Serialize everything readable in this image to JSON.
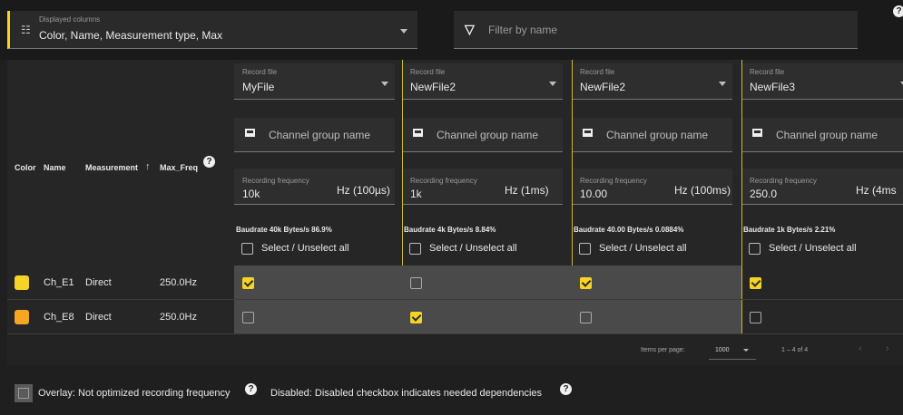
{
  "toolbar": {
    "columns_label": "Displayed columns",
    "columns_value": "Color, Name, Measurement type, Max",
    "filter_placeholder": "Filter by name"
  },
  "table": {
    "headers": {
      "color": "Color",
      "name": "Name",
      "measurement": "Measurement",
      "max_freq": "Max_Freq"
    },
    "sort_direction": "ascending",
    "record_columns": [
      {
        "record_file_label": "Record file",
        "record_file": "MyFile",
        "channel_group_placeholder": "Channel group name",
        "freq_label": "Recording frequency",
        "freq_value": "10k",
        "freq_unit": "Hz (100µs)",
        "baudrate": "Baudrate 40k Bytes/s 86.9%",
        "select_all": "Select / Unselect all"
      },
      {
        "record_file_label": "Record file",
        "record_file": "NewFile2",
        "channel_group_placeholder": "Channel group name",
        "freq_label": "Recording frequency",
        "freq_value": "1k",
        "freq_unit": "Hz (1ms)",
        "baudrate": "Baudrate 4k Bytes/s 8.84%",
        "select_all": "Select / Unselect all"
      },
      {
        "record_file_label": "Record file",
        "record_file": "NewFile2",
        "channel_group_placeholder": "Channel group name",
        "freq_label": "Recording frequency",
        "freq_value": "10.00",
        "freq_unit": "Hz (100ms)",
        "baudrate": "Baudrate 40.00 Bytes/s 0.0884%",
        "select_all": "Select / Unselect all"
      },
      {
        "record_file_label": "Record file",
        "record_file": "NewFile3",
        "channel_group_placeholder": "Channel group name",
        "freq_label": "Recording frequency",
        "freq_value": "250.0",
        "freq_unit": "Hz (4ms",
        "baudrate": "Baudrate 1k Bytes/s 2.21%",
        "select_all": "Select / Unselect all"
      }
    ],
    "rows": [
      {
        "color": "#f5d327",
        "name": "Ch_E1",
        "measurement": "Direct",
        "max_freq": "250.0Hz",
        "checks": [
          true,
          false,
          true,
          true
        ]
      },
      {
        "color": "#f5a623",
        "name": "Ch_E8",
        "measurement": "Direct",
        "max_freq": "250.0Hz",
        "checks": [
          false,
          true,
          false,
          false
        ]
      }
    ]
  },
  "paginator": {
    "items_per_page_label": "Items per page:",
    "items_per_page": "1000",
    "range": "1 – 4 of 4"
  },
  "legend": {
    "overlay": "Overlay: Not optimized recording frequency",
    "disabled": "Disabled: Disabled checkbox indicates needed dependencies"
  },
  "colors": {
    "accent": "#f5d327",
    "row_highlight": "#4a4a4a"
  }
}
